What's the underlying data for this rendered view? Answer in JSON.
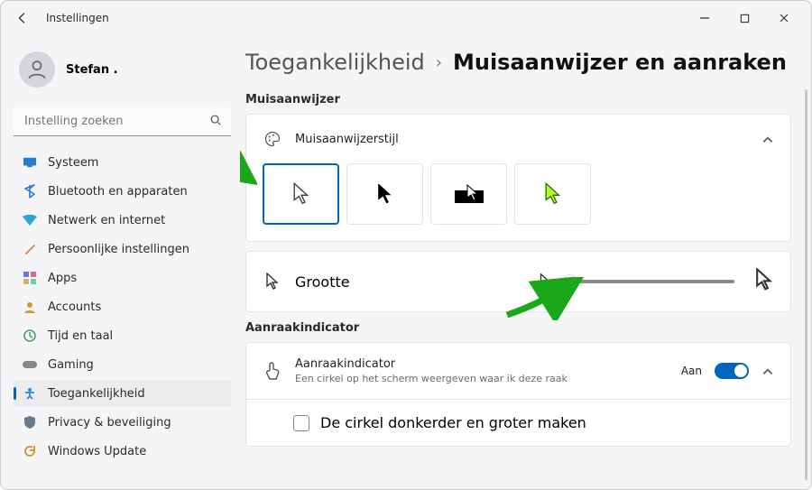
{
  "window": {
    "title": "Instellingen"
  },
  "profile": {
    "name": "Stefan ."
  },
  "search": {
    "placeholder": "Instelling zoeken"
  },
  "nav": {
    "items": [
      {
        "label": "Systeem",
        "color": "#2a7ad4"
      },
      {
        "label": "Bluetooth en apparaten",
        "color": "#2a7ad4"
      },
      {
        "label": "Netwerk en internet",
        "color": "#2aa8d4"
      },
      {
        "label": "Persoonlijke instellingen",
        "color": "#d46a2a"
      },
      {
        "label": "Apps",
        "color": "#7a6ad4"
      },
      {
        "label": "Accounts",
        "color": "#d49a2a"
      },
      {
        "label": "Tijd en taal",
        "color": "#4aa06a"
      },
      {
        "label": "Gaming",
        "color": "#888888"
      },
      {
        "label": "Toegankelijkheid",
        "color": "#2a8ad4",
        "selected": true
      },
      {
        "label": "Privacy & beveiliging",
        "color": "#6a7a8a"
      },
      {
        "label": "Windows Update",
        "color": "#d4902a"
      }
    ]
  },
  "breadcrumb": {
    "parent": "Toegankelijkheid",
    "current": "Muisaanwijzer en aanraken"
  },
  "sections": {
    "pointer_title": "Muisaanwijzer",
    "style_label": "Muisaanwijzerstijl",
    "size_label": "Grootte",
    "touch_title": "Aanraakindicator",
    "touch_label": "Aanraakindicator",
    "touch_desc": "Een cirkel op het scherm weergeven waar ik deze raak",
    "touch_state": "Aan",
    "touch_sub": "De cirkel donkerder en groter maken"
  }
}
